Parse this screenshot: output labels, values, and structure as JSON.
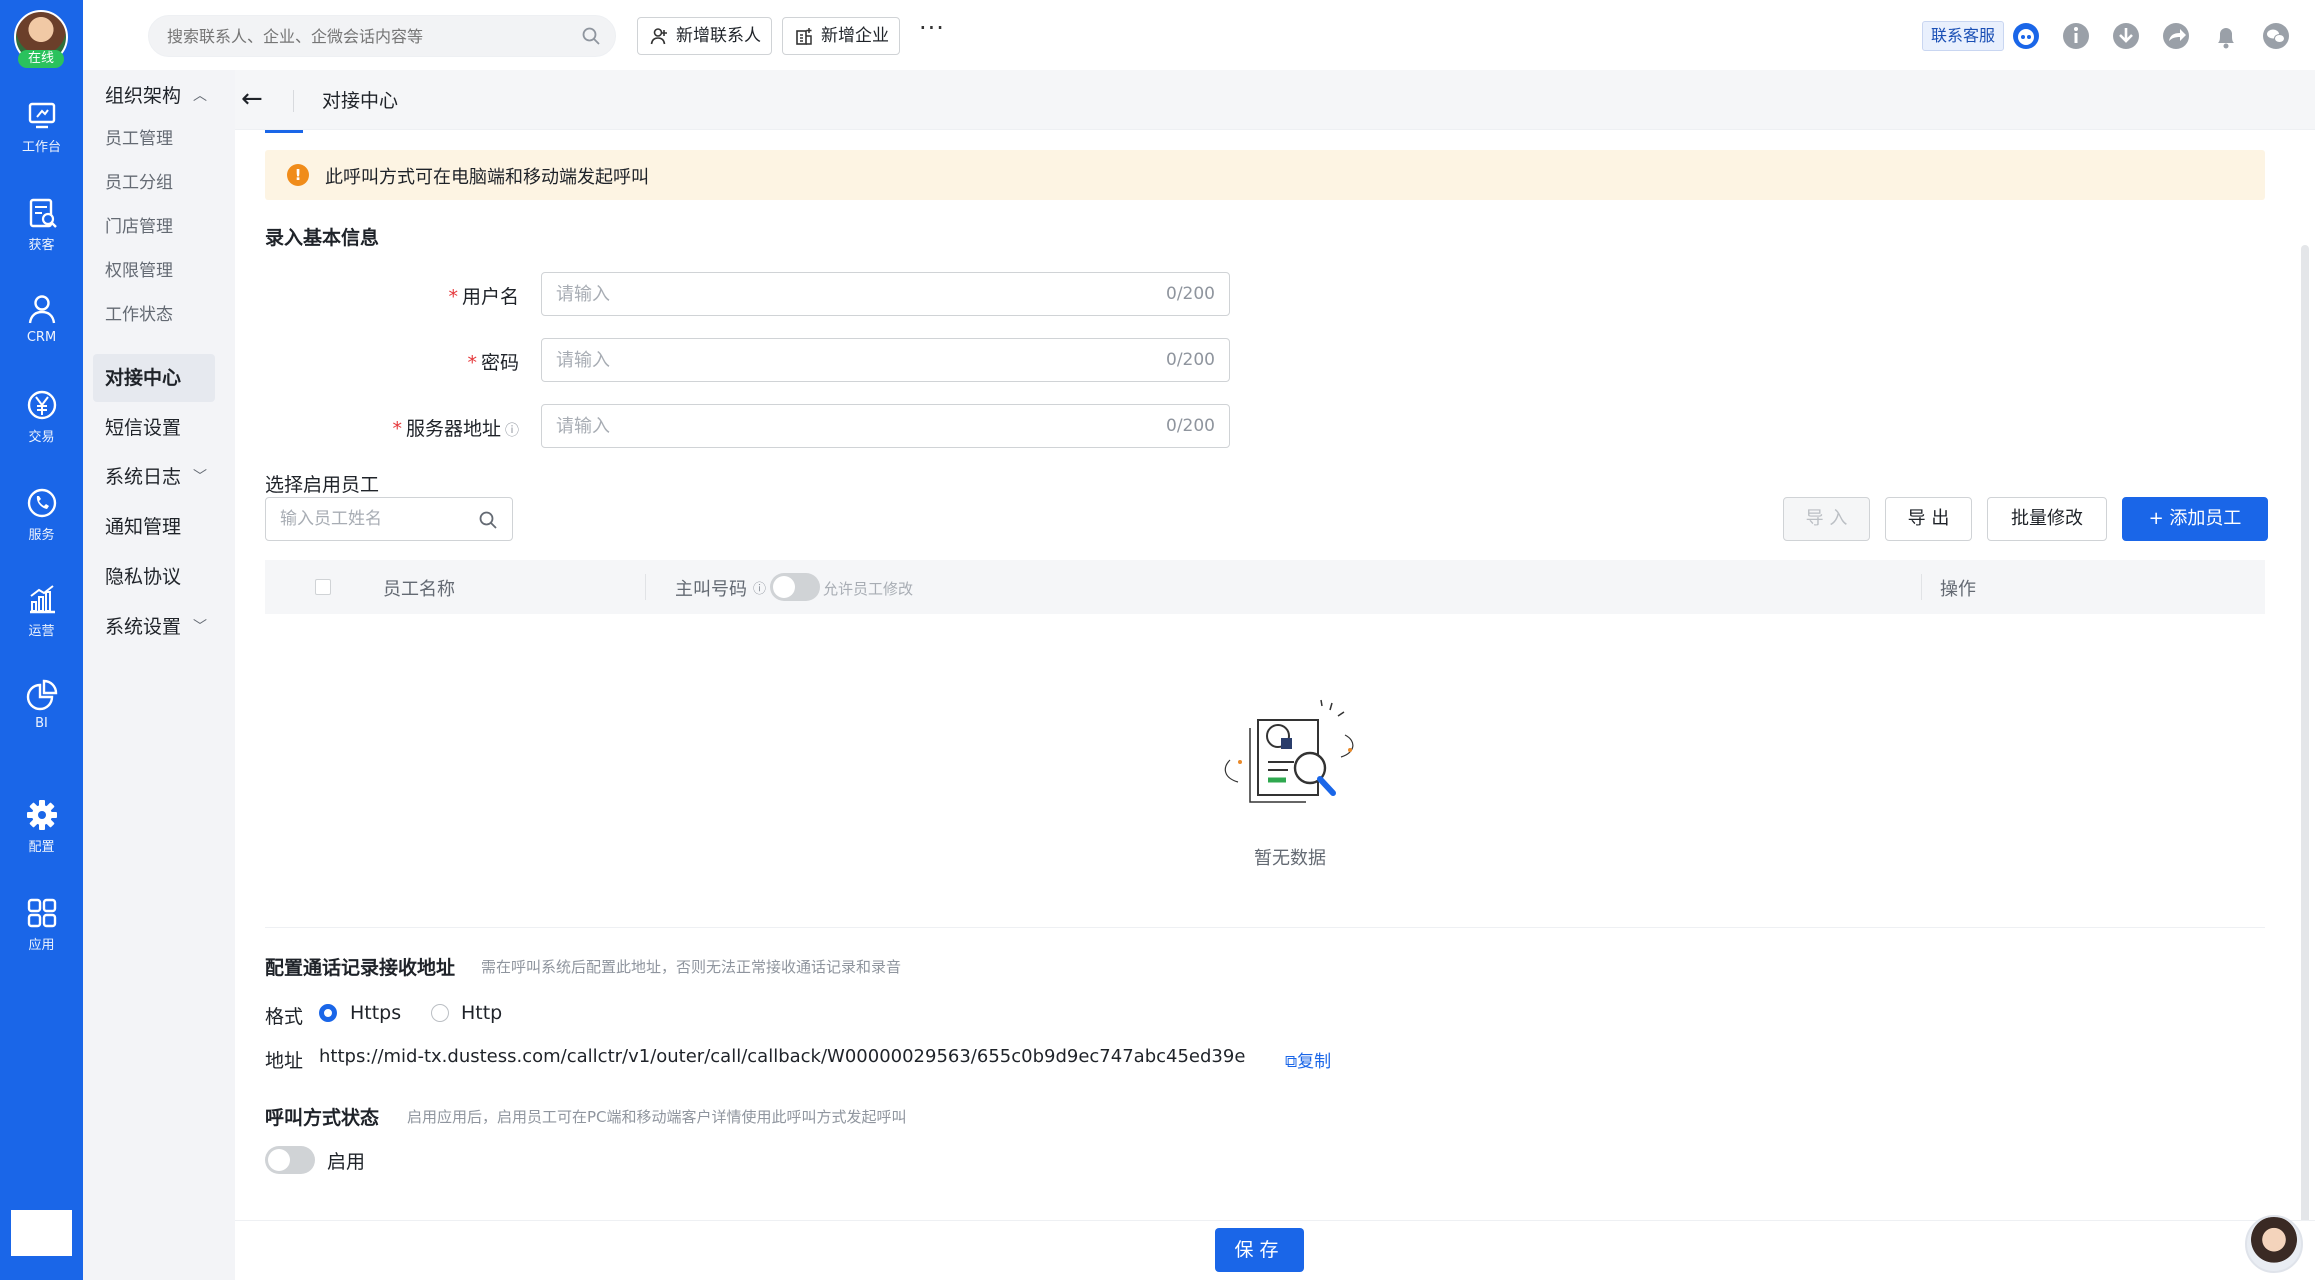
{
  "user": {
    "status": "在线"
  },
  "rail": [
    {
      "label": "工作台",
      "icon": "dashboard-icon"
    },
    {
      "label": "获客",
      "icon": "acquire-icon"
    },
    {
      "label": "CRM",
      "icon": "person-icon"
    },
    {
      "label": "交易",
      "icon": "yen-icon"
    },
    {
      "label": "服务",
      "icon": "phone-icon"
    },
    {
      "label": "运营",
      "icon": "growth-chart-icon"
    },
    {
      "label": "BI",
      "icon": "pie-chart-icon"
    },
    {
      "label": "配置",
      "icon": "gear-icon"
    },
    {
      "label": "应用",
      "icon": "apps-grid-icon"
    }
  ],
  "subnav": {
    "org": "组织架构",
    "employee_mgmt": "员工管理",
    "employee_group": "员工分组",
    "store_mgmt": "门店管理",
    "permission_mgmt": "权限管理",
    "work_status": "工作状态",
    "docking_center": "对接中心",
    "sms_settings": "短信设置",
    "system_log": "系统日志",
    "notice_mgmt": "通知管理",
    "privacy": "隐私协议",
    "system_settings": "系统设置"
  },
  "topbar": {
    "search_placeholder": "搜索联系人、企业、企微会话内容等",
    "new_contact": "新增联系人",
    "new_company": "新增企业",
    "more": "···",
    "customer_service": "联系客服"
  },
  "breadcrumb": {
    "title": "对接中心"
  },
  "notice": {
    "icon": "!",
    "text": "此呼叫方式可在电脑端和移动端发起呼叫"
  },
  "basic_info": {
    "title": "录入基本信息",
    "username_label": "用户名",
    "password_label": "密码",
    "server_label": "服务器地址",
    "placeholder": "请输入",
    "counter": "0/200",
    "required_mark": "*",
    "info_mark": "ⓘ"
  },
  "employees": {
    "title": "选择启用员工",
    "search_placeholder": "输入员工姓名",
    "import": "导 入",
    "export": "导 出",
    "batch_edit": "批量修改",
    "add": "+ 添加员工",
    "col_name": "员工名称",
    "col_caller": "主叫号码",
    "col_caller_info": "ⓘ",
    "allow_edit": "允许员工修改",
    "col_action": "操作",
    "empty": "暂无数据"
  },
  "callback": {
    "title": "配置通话记录接收地址",
    "hint": "需在呼叫系统后配置此地址，否则无法正常接收通话记录和录音",
    "format_label": "格式",
    "opt_https": "Https",
    "opt_http": "Http",
    "selected": "Https",
    "address_label": "地址",
    "address": "https://mid-tx.dustess.com/callctr/v1/outer/call/callback/W00000029563/655c0b9d9ec747abc45ed39e",
    "copy": "复制"
  },
  "call_status": {
    "title": "呼叫方式状态",
    "hint": "启用应用后，启用员工可在PC端和移动端客户详情使用此呼叫方式发起呼叫",
    "toggle_label": "启用",
    "enabled": false
  },
  "footer": {
    "save": "保存"
  },
  "colors": {
    "primary": "#1a66e8",
    "warning": "#f08c1a",
    "notice_bg": "#fdf4e3"
  }
}
